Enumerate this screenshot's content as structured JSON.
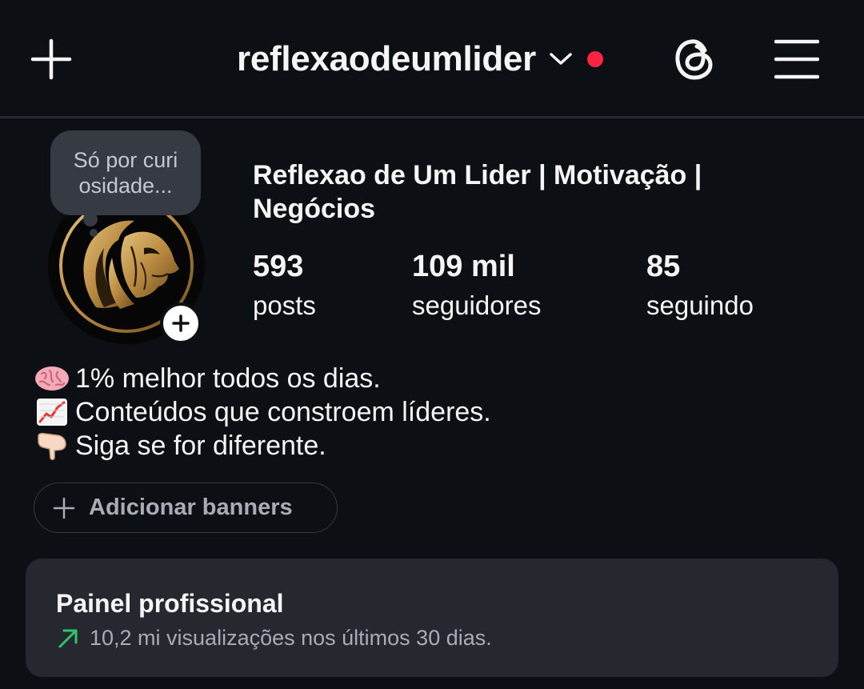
{
  "header": {
    "username": "reflexaodeumlider"
  },
  "icons": {
    "create": "plus-icon",
    "account_switch": "chevron-down-icon",
    "notification": "red-dot",
    "threads": "threads-icon",
    "menu": "hamburger-menu-icon",
    "story_add": "plus-icon",
    "banners_add": "plus-icon",
    "insights_trend": "trend-up-arrow-icon"
  },
  "colors": {
    "background": "#0c1014",
    "notification_dot": "#ff2442",
    "trend_green": "#31c46b",
    "card_background": "#25292f"
  },
  "profile": {
    "note_text": "Só por curi osidade...",
    "full_name": "Reflexao de Um Lider | Motivação | Negócios",
    "stats": {
      "posts": {
        "value": "593",
        "label": "posts"
      },
      "followers": {
        "value": "109 mil",
        "label": "seguidores"
      },
      "following": {
        "value": "85",
        "label": "seguindo"
      }
    },
    "bio": [
      {
        "emoji": "brain",
        "text": "1% melhor todos os dias."
      },
      {
        "emoji": "chart-increasing",
        "text": "Conteúdos que constroem líderes."
      },
      {
        "emoji": "backhand-index-pointing-down",
        "text": "Siga se for diferente."
      }
    ]
  },
  "banners": {
    "label": "Adicionar banners"
  },
  "professional_panel": {
    "title": "Painel profissional",
    "subtitle": "10,2 mi visualizações nos últimos 30 dias."
  }
}
